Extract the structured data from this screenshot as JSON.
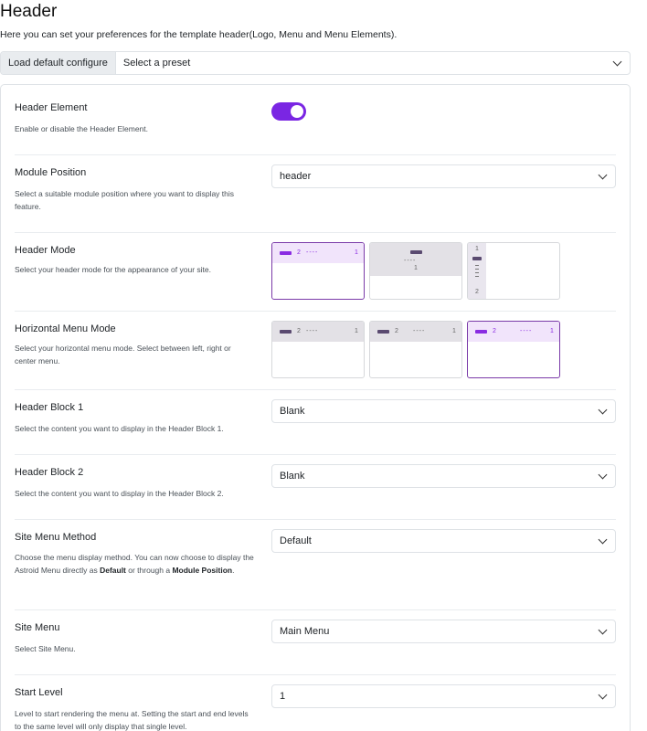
{
  "header": {
    "title": "Header",
    "description": "Here you can set your preferences for the template header(Logo, Menu and Menu Elements)."
  },
  "preset": {
    "load_button": "Load default configure",
    "select_placeholder": "Select a preset"
  },
  "colors": {
    "accent": "#7a26e3",
    "selected_border": "#7a3aa8"
  },
  "rows": {
    "header_element": {
      "label": "Header Element",
      "help": "Enable or disable the Header Element.",
      "enabled": true
    },
    "module_position": {
      "label": "Module Position",
      "help": "Select a suitable module position where you want to display this feature.",
      "value": "header"
    },
    "header_mode": {
      "label": "Header Mode",
      "help": "Select your header mode for the appearance of your site.",
      "options": [
        {
          "n1": "2",
          "n2": "1",
          "dashes": "----"
        },
        {
          "n1": "1",
          "dashes": "----"
        },
        {
          "n1": "1",
          "n2": "2"
        }
      ],
      "selected_index": 0
    },
    "horizontal_menu_mode": {
      "label": "Horizontal Menu Mode",
      "help": "Select your horizontal menu mode. Select between left, right or center menu.",
      "options": [
        {
          "n1": "2",
          "n2": "1",
          "dashes": "----"
        },
        {
          "n1": "2",
          "n2": "1",
          "dashes": "----"
        },
        {
          "n1": "2",
          "n2": "1",
          "dashes": "----"
        }
      ],
      "selected_index": 2
    },
    "header_block_1": {
      "label": "Header Block 1",
      "help": "Select the content you want to display in the Header Block 1.",
      "value": "Blank"
    },
    "header_block_2": {
      "label": "Header Block 2",
      "help": "Select the content you want to display in the Header Block 2.",
      "value": "Blank"
    },
    "site_menu_method": {
      "label": "Site Menu Method",
      "help_prefix": "Choose the menu display method. You can now choose to display the Astroid Menu directly as ",
      "help_bold1": "Default",
      "help_mid": " or through a ",
      "help_bold2": "Module Position",
      "help_suffix": ".",
      "value": "Default"
    },
    "site_menu": {
      "label": "Site Menu",
      "help": "Select Site Menu.",
      "value": "Main Menu"
    },
    "start_level": {
      "label": "Start Level",
      "help": "Level to start rendering the menu at. Setting the start and end levels to the same level will only display that single level.",
      "value": "1"
    }
  }
}
